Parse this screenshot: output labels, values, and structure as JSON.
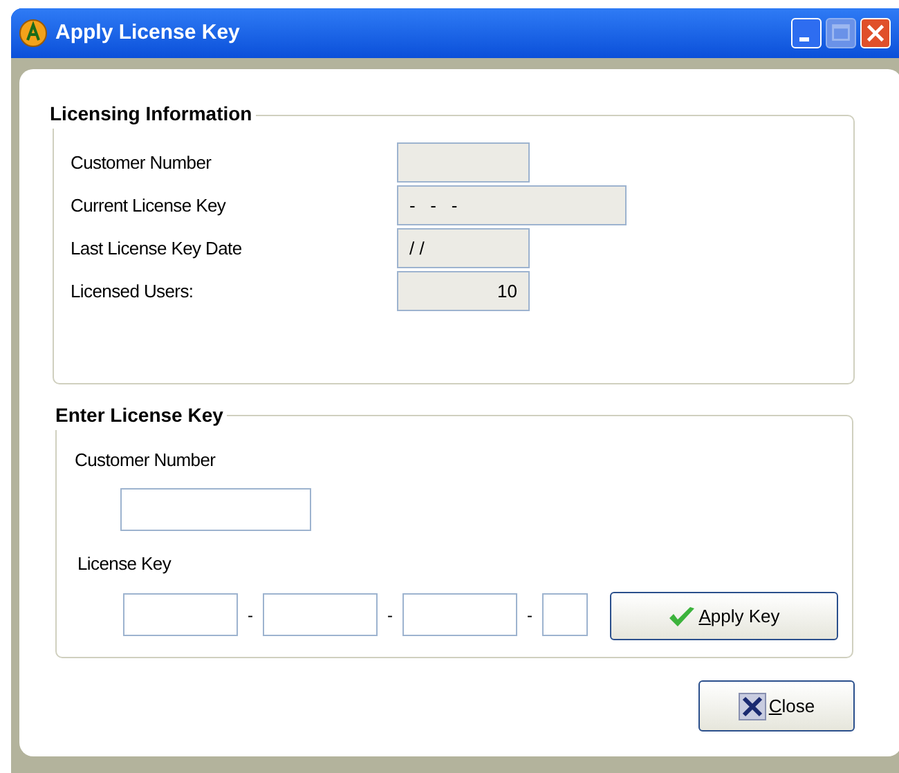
{
  "window": {
    "title": "Apply License Key",
    "controls": [
      {
        "kind": "minimize",
        "disabled": false
      },
      {
        "kind": "maximize",
        "disabled": true
      },
      {
        "kind": "close",
        "disabled": false
      }
    ]
  },
  "licensing_information": {
    "title": "Licensing Information",
    "fields": [
      {
        "label": "Customer Number"
      },
      {
        "label": "Current License Key",
        "value": "-   -   -"
      },
      {
        "label": "Last License Key Date",
        "value": "/ /"
      },
      {
        "label": "Licensed Users:",
        "value": "10"
      }
    ]
  },
  "enter_license_key": {
    "title": "Enter License Key",
    "customer_number_label": "Customer Number",
    "license_key_label": "License Key",
    "separators": [
      "-",
      "-",
      "-"
    ],
    "apply_button": "Apply Key"
  },
  "close_button": "Close"
}
